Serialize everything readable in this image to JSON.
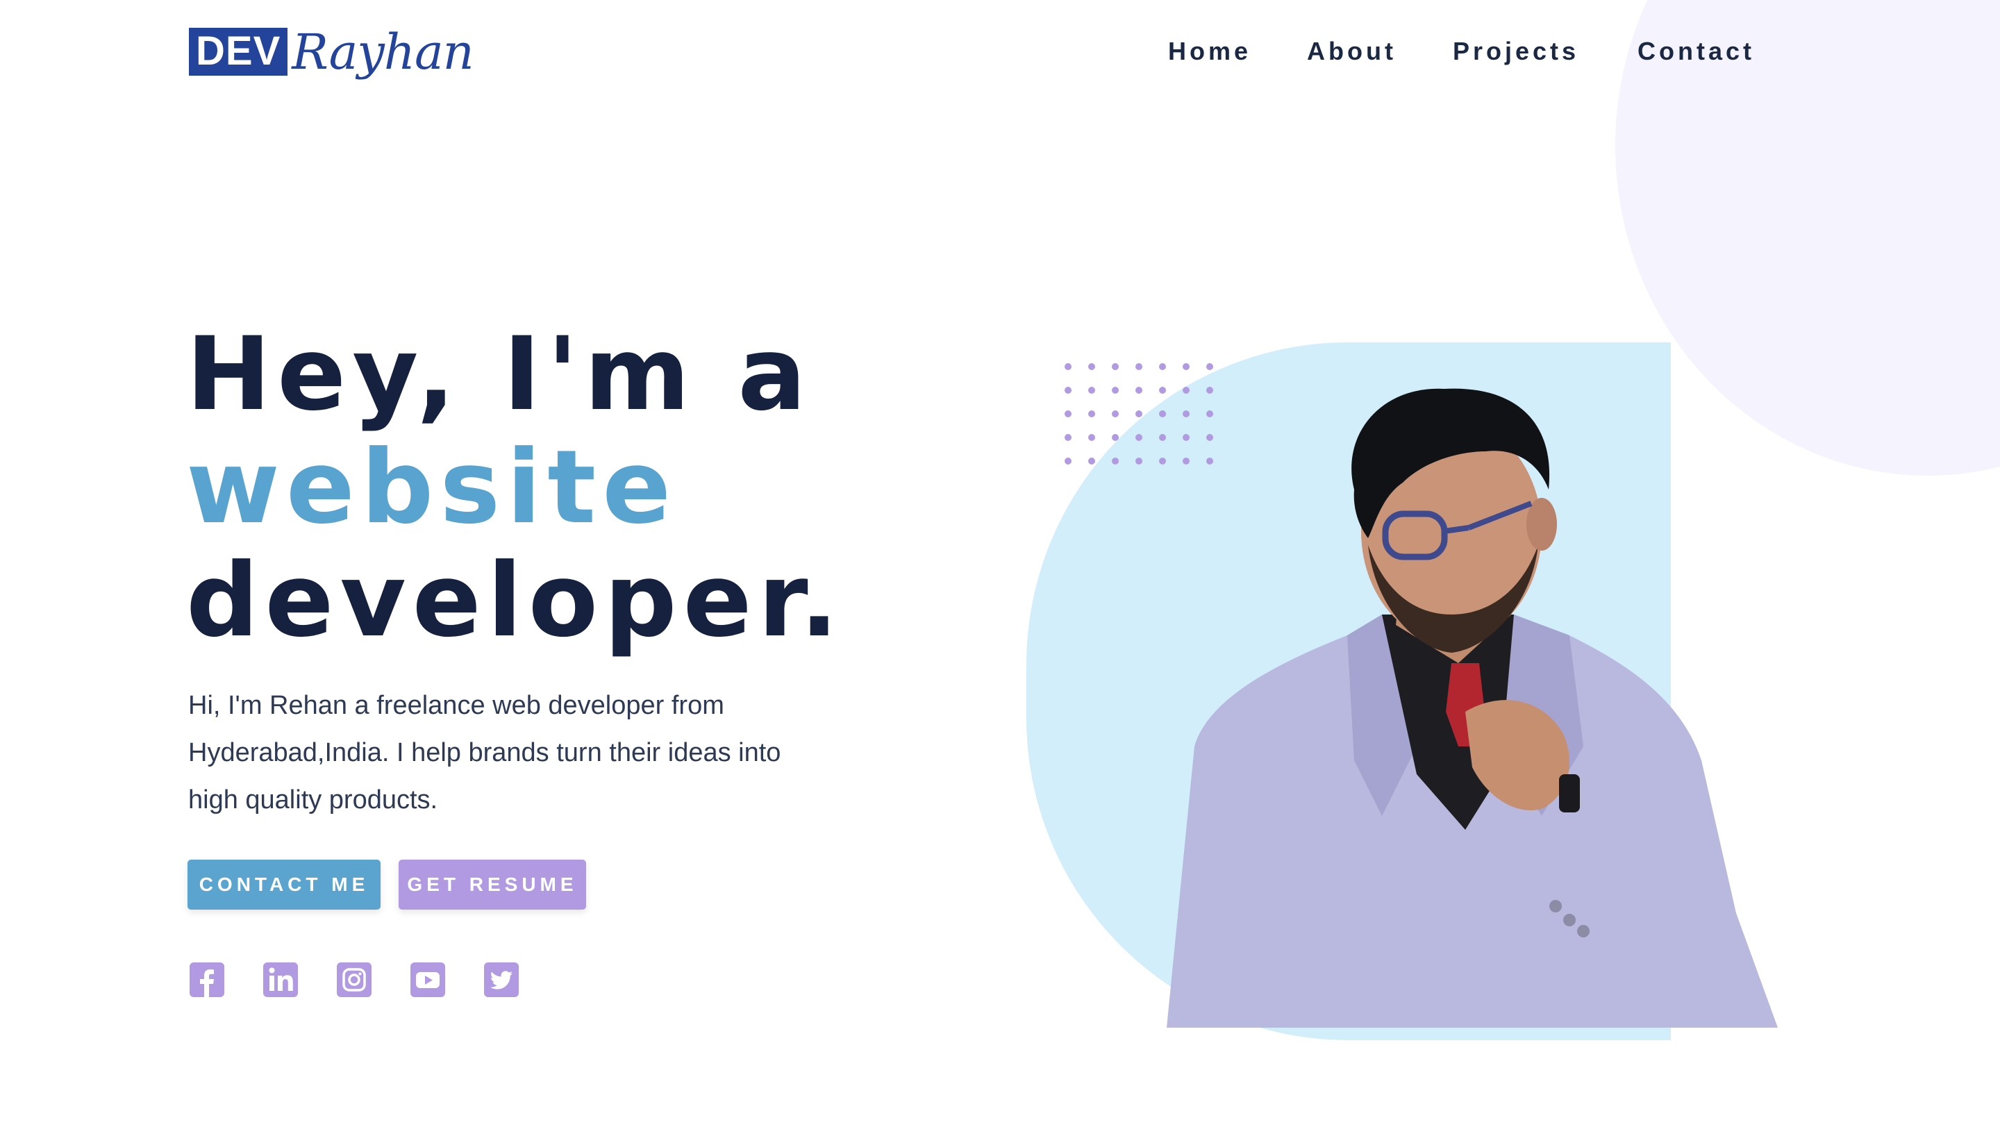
{
  "header": {
    "logo": {
      "badge_text": "DEV",
      "script_text": "Rayhan"
    },
    "nav": [
      {
        "label": "Home"
      },
      {
        "label": "About"
      },
      {
        "label": "Projects"
      },
      {
        "label": "Contact"
      }
    ]
  },
  "hero": {
    "headline": {
      "line1": "Hey, I'm a",
      "line2": "website",
      "line3": "developer."
    },
    "intro": {
      "line1": "Hi, I'm Rehan a freelance web developer from",
      "line2": "Hyderabad,India. I help brands turn their ideas into",
      "line3": "high quality products."
    },
    "buttons": {
      "contact_label": "CONTACT ME",
      "resume_label": "GET RESUME"
    },
    "social_icons": [
      "facebook-icon",
      "linkedin-icon",
      "instagram-icon",
      "youtube-icon",
      "twitter-icon"
    ]
  },
  "colors": {
    "navy": "#16213f",
    "accent_blue": "#58a3cf",
    "accent_purple": "#b19ae1",
    "logo_blue": "#23449a",
    "blob_blue": "#d2eefb",
    "bg_circle": "#f5f3fd"
  }
}
